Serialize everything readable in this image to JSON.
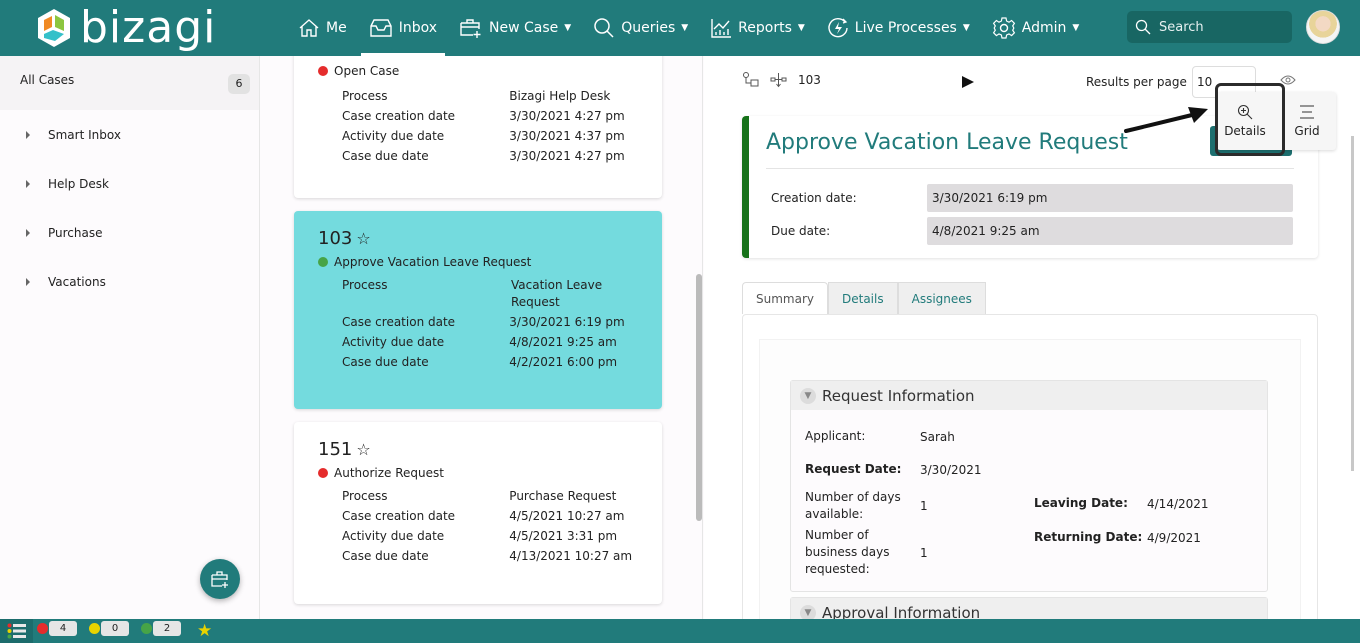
{
  "app": {
    "brand": "bizagi",
    "brand_colors": {
      "primary": "#217b7b",
      "selected_card": "#74dbde",
      "accent_green": "#167219"
    }
  },
  "nav": {
    "items": [
      {
        "label": "Me",
        "icon": "home-icon",
        "has_menu": false
      },
      {
        "label": "Inbox",
        "icon": "inbox-icon",
        "has_menu": false,
        "active": true
      },
      {
        "label": "New Case",
        "icon": "new-case-icon",
        "has_menu": true
      },
      {
        "label": "Queries",
        "icon": "search-icon",
        "has_menu": true
      },
      {
        "label": "Reports",
        "icon": "chart-icon",
        "has_menu": true
      },
      {
        "label": "Live Processes",
        "icon": "lightning-icon",
        "has_menu": true
      },
      {
        "label": "Admin",
        "icon": "gear-icon",
        "has_menu": true
      }
    ],
    "search_placeholder": "Search"
  },
  "sidebar": {
    "all_cases_label": "All Cases",
    "all_cases_count": "6",
    "items": [
      {
        "label": "Smart Inbox"
      },
      {
        "label": "Help Desk"
      },
      {
        "label": "Purchase"
      },
      {
        "label": "Vacations"
      }
    ]
  },
  "cases": [
    {
      "number": "",
      "activity": "Open Case",
      "status": "red",
      "props": [
        {
          "k": "Process",
          "v": "Bizagi Help Desk"
        },
        {
          "k": "Case creation date",
          "v": "3/30/2021 4:27 pm"
        },
        {
          "k": "Activity due date",
          "v": "3/30/2021 4:37 pm"
        },
        {
          "k": "Case due date",
          "v": "3/30/2021 4:27 pm"
        }
      ]
    },
    {
      "number": "103",
      "activity": "Approve Vacation Leave Request",
      "status": "green",
      "selected": true,
      "props": [
        {
          "k": "Process",
          "v": "Vacation Leave Request"
        },
        {
          "k": "Case creation date",
          "v": "3/30/2021 6:19 pm"
        },
        {
          "k": "Activity due date",
          "v": "4/8/2021 9:25 am"
        },
        {
          "k": "Case due date",
          "v": "4/2/2021 6:00 pm"
        }
      ]
    },
    {
      "number": "151",
      "activity": "Authorize Request",
      "status": "red",
      "props": [
        {
          "k": "Process",
          "v": "Purchase Request"
        },
        {
          "k": "Case creation date",
          "v": "4/5/2021 10:27 am"
        },
        {
          "k": "Activity due date",
          "v": "4/5/2021 3:31 pm"
        },
        {
          "k": "Case due date",
          "v": "4/13/2021 10:27 am"
        }
      ]
    }
  ],
  "detail": {
    "case_number": "103",
    "results_per_page_label": "Results per page",
    "results_per_page_value": "10",
    "view_options": {
      "details": "Details",
      "grid": "Grid"
    },
    "title": "Approve Vacation Leave Request",
    "creation_date_label": "Creation date:",
    "creation_date_value": "3/30/2021 6:19 pm",
    "due_date_label": "Due date:",
    "due_date_value": "4/8/2021 9:25 am",
    "tabs": [
      "Summary",
      "Details",
      "Assignees"
    ],
    "active_tab": "Summary",
    "groups": {
      "request": {
        "title": "Request Information",
        "applicant_label": "Applicant:",
        "applicant_value": "Sarah",
        "request_date_label": "Request Date:",
        "request_date_value": "3/30/2021",
        "days_available_label": "Number of days available:",
        "days_available_value": "1",
        "days_requested_label": "Number of business days requested:",
        "days_requested_value": "1",
        "leaving_date_label": "Leaving Date:",
        "leaving_date_value": "4/14/2021",
        "returning_date_label": "Returning Date:",
        "returning_date_value": "4/9/2021"
      },
      "approval": {
        "title": "Approval Information"
      }
    }
  },
  "bottombar": {
    "red_count": "4",
    "yellow_count": "0",
    "green_count": "2"
  }
}
